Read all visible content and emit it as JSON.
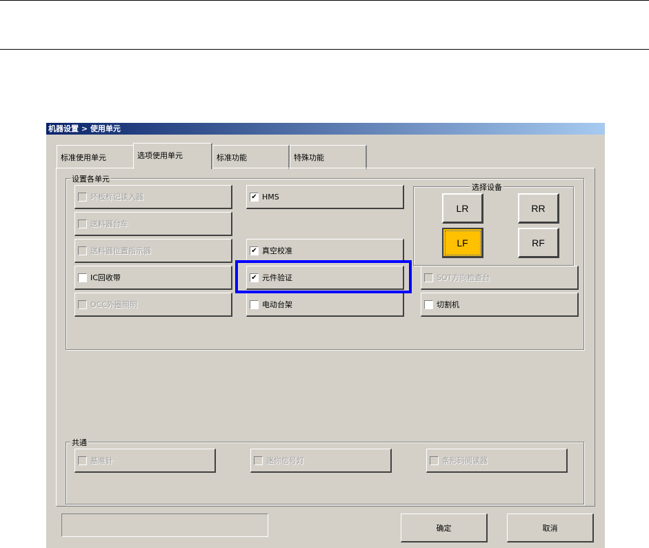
{
  "window": {
    "title": "机器设置 > 使用单元"
  },
  "tabs": [
    "标准使用单元",
    "选项使用单元",
    "标准功能",
    "特殊功能"
  ],
  "active_tab": "选项使用单元",
  "units_group": {
    "label": "设置各单元",
    "col1": [
      {
        "label": "坏板标记读入器",
        "checked": false,
        "enabled": false
      },
      {
        "label": "送料器台车",
        "checked": false,
        "enabled": false
      },
      {
        "label": "送料器位置指示器",
        "checked": false,
        "enabled": false
      },
      {
        "label": "IC回收带",
        "checked": false,
        "enabled": true
      },
      {
        "label": "OCC外圈照明",
        "checked": false,
        "enabled": false
      }
    ],
    "col2": [
      {
        "label": "HMS",
        "checked": true,
        "enabled": true
      },
      {
        "label": "真空校准",
        "checked": true,
        "enabled": true
      },
      {
        "label": "元件验证",
        "checked": true,
        "enabled": true
      },
      {
        "label": "电动台架",
        "checked": false,
        "enabled": true
      }
    ],
    "col3": [
      {
        "label": "SOT方向检查台",
        "checked": false,
        "enabled": false
      },
      {
        "label": "切割机",
        "checked": false,
        "enabled": true
      }
    ],
    "device_select": {
      "label": "选择设备",
      "buttons": [
        "LR",
        "RR",
        "LF",
        "RF"
      ],
      "selected": "LF",
      "accent": "#ffc000"
    }
  },
  "common_group": {
    "label": "共通",
    "items": [
      {
        "label": "基准针",
        "checked": false,
        "enabled": false
      },
      {
        "label": "迷你信号灯",
        "checked": false,
        "enabled": false
      },
      {
        "label": "条形码阅读器",
        "checked": false,
        "enabled": false
      }
    ]
  },
  "footer": {
    "status": "",
    "ok": "确定",
    "cancel": "取消"
  },
  "highlight_color": "#0000ff"
}
